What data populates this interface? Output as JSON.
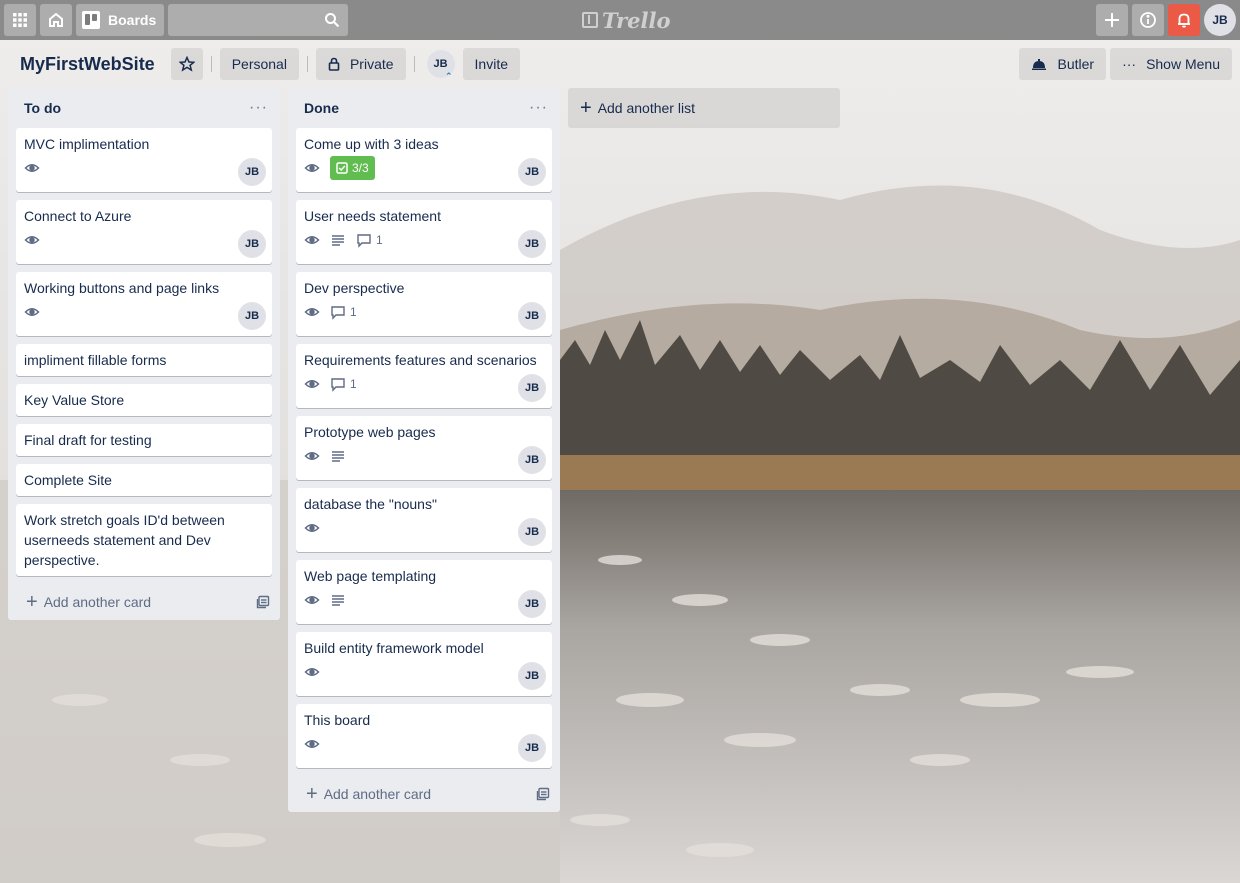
{
  "topbar": {
    "boards_label": "Boards",
    "logo_text": "Trello",
    "user_initials": "JB"
  },
  "board": {
    "title": "MyFirstWebSite",
    "team_label": "Personal",
    "visibility_label": "Private",
    "member_initials": "JB",
    "invite_label": "Invite",
    "butler_label": "Butler",
    "menu_label": "Show Menu"
  },
  "lists": [
    {
      "title": "To do",
      "add_card_label": "Add another card",
      "cards": [
        {
          "title": "MVC implimentation",
          "member": "JB"
        },
        {
          "title": "Connect to Azure",
          "member": "JB"
        },
        {
          "title": "Working buttons and page links",
          "member": "JB"
        },
        {
          "title": "impliment fillable forms"
        },
        {
          "title": "Key Value Store"
        },
        {
          "title": "Final draft for testing"
        },
        {
          "title": "Complete Site"
        },
        {
          "title": "Work stretch goals ID'd between userneeds statement and Dev perspective."
        }
      ]
    },
    {
      "title": "Done",
      "add_card_label": "Add another card",
      "cards": [
        {
          "title": "Come up with 3 ideas",
          "checklist": "3/3",
          "member": "JB"
        },
        {
          "title": "User needs statement",
          "comments": "1",
          "member": "JB"
        },
        {
          "title": "Dev perspective",
          "comments": "1",
          "member": "JB"
        },
        {
          "title": "Requirements features and scenarios",
          "comments": "1",
          "member": "JB"
        },
        {
          "title": "Prototype web pages",
          "member": "JB"
        },
        {
          "title": "database the \"nouns\"",
          "member": "JB"
        },
        {
          "title": "Web page templating",
          "member": "JB"
        },
        {
          "title": "Build entity framework model",
          "member": "JB"
        },
        {
          "title": "This board",
          "member": "JB"
        }
      ]
    }
  ],
  "add_list_label": "Add another list",
  "colors": {
    "checklist_complete": "#61bd4f",
    "notification_bell": "#eb5a46",
    "list_bg": "#ebecf0"
  }
}
